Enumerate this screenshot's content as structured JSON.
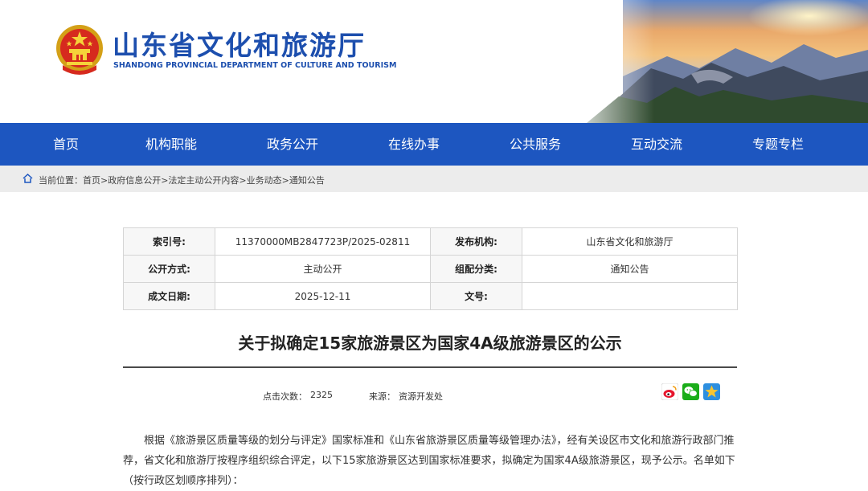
{
  "header": {
    "title": "山东省文化和旅游厅",
    "subtitle": "SHANDONG PROVINCIAL DEPARTMENT OF CULTURE AND  TOURISM"
  },
  "nav": {
    "items": [
      {
        "label": "首页"
      },
      {
        "label": "机构职能"
      },
      {
        "label": "政务公开"
      },
      {
        "label": "在线办事"
      },
      {
        "label": "公共服务"
      },
      {
        "label": "互动交流"
      },
      {
        "label": "专题专栏"
      }
    ]
  },
  "breadcrumb": {
    "text": "当前位置：首页>政府信息公开>法定主动公开内容>业务动态>通知公告"
  },
  "info": {
    "index_label": "索引号:",
    "index_value": "11370000MB2847723P/2025-02811",
    "publisher_label": "发布机构:",
    "publisher_value": "山东省文化和旅游厅",
    "method_label": "公开方式:",
    "method_value": "主动公开",
    "category_label": "组配分类:",
    "category_value": "通知公告",
    "date_label": "成文日期:",
    "date_value": "2025-12-11",
    "doc_label": "文号:",
    "doc_value": ""
  },
  "article": {
    "title": "关于拟确定15家旅游景区为国家4A级旅游景区的公示",
    "views_label": "点击次数：",
    "views_value": "2325",
    "source_label": "来源：",
    "source_value": "资源开发处",
    "body": "根据《旅游景区质量等级的划分与评定》国家标准和《山东省旅游景区质量等级管理办法》，经有关设区市文化和旅游行政部门推荐，省文化和旅游厅按程序组织综合评定，以下15家旅游景区达到国家标准要求，拟确定为国家4A级旅游景区，现予公示。名单如下（按行政区划顺序排列）："
  },
  "share": {
    "weibo_icon": "weibo-icon",
    "wechat_icon": "wechat-icon",
    "qzone_icon": "qzone-star-icon"
  },
  "colors": {
    "brand_blue": "#1d56c0",
    "title_blue": "#1d4fae"
  }
}
